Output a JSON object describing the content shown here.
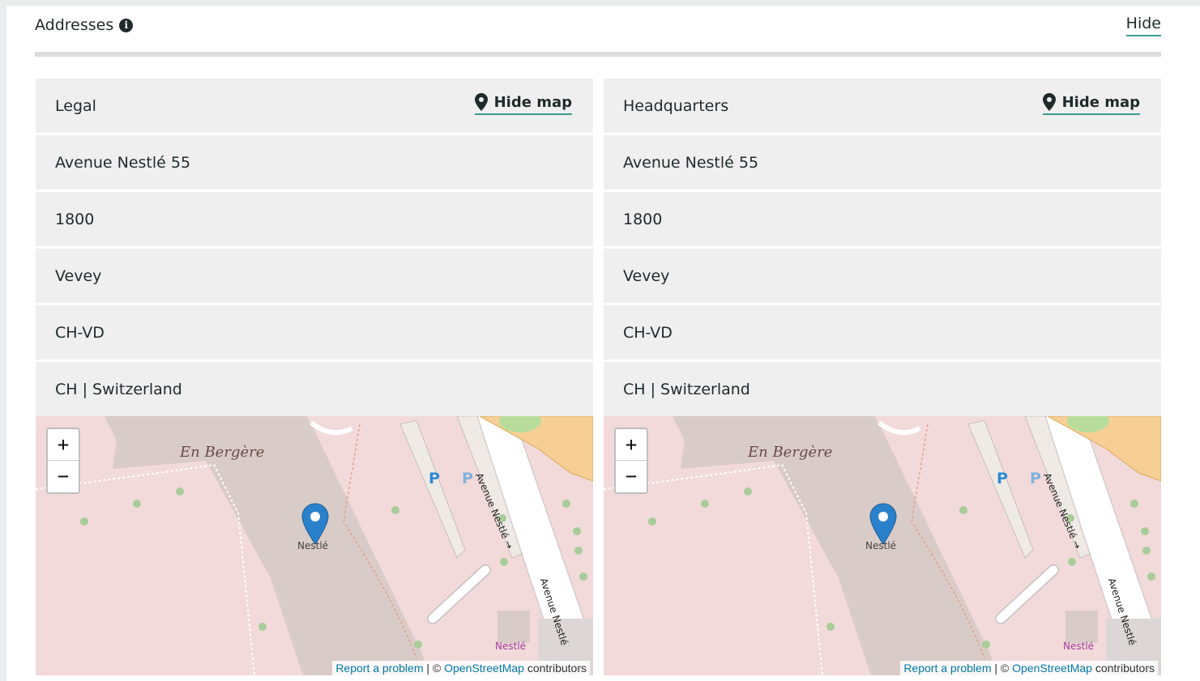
{
  "section": {
    "title": "Addresses",
    "hide_label": "Hide"
  },
  "panels": [
    {
      "title": "Legal",
      "hide_map_label": "Hide map",
      "street": "Avenue Nestlé 55",
      "postal_code": "1800",
      "city": "Vevey",
      "region": "CH-VD",
      "country": "CH | Switzerland"
    },
    {
      "title": "Headquarters",
      "hide_map_label": "Hide map",
      "street": "Avenue Nestlé 55",
      "postal_code": "1800",
      "city": "Vevey",
      "region": "CH-VD",
      "country": "CH | Switzerland"
    }
  ],
  "map": {
    "zoom_in": "+",
    "zoom_out": "−",
    "area_label": "En Bergère",
    "marker_label": "Nestlé",
    "shop_label": "Nestlé",
    "road_label_1": "Avenue Nestlé →",
    "road_label_2": "Avenue Nestlé",
    "parking": "P",
    "attribution": {
      "report": "Report a problem",
      "separator": " | © ",
      "osm": "OpenStreetMap",
      "contributors": " contributors"
    }
  },
  "colors": {
    "accent": "#3a9c8f",
    "marker": "#2a81cb",
    "row_bg": "#efefef"
  }
}
